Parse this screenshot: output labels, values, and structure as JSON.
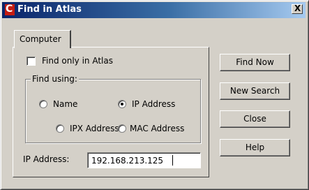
{
  "window": {
    "title": "Find in Atlas",
    "close_label": "X"
  },
  "tabs": [
    {
      "label": "Computer",
      "active": true
    }
  ],
  "find_only": {
    "label": "Find only in Atlas",
    "checked": false
  },
  "find_using": {
    "label": "Find using:",
    "options": [
      {
        "label": "Name",
        "selected": false
      },
      {
        "label": "IP Address",
        "selected": true
      },
      {
        "label": "IPX Address",
        "selected": false
      },
      {
        "label": "MAC Address",
        "selected": false
      }
    ]
  },
  "ip_address": {
    "label": "IP Address:",
    "value": "192.168.213.125"
  },
  "buttons": {
    "find_now": "Find Now",
    "new_search": "New Search",
    "close": "Close",
    "help": "Help"
  },
  "colors": {
    "face": "#d4d0c8",
    "title_start": "#0a246a",
    "title_end": "#a6caf0"
  }
}
